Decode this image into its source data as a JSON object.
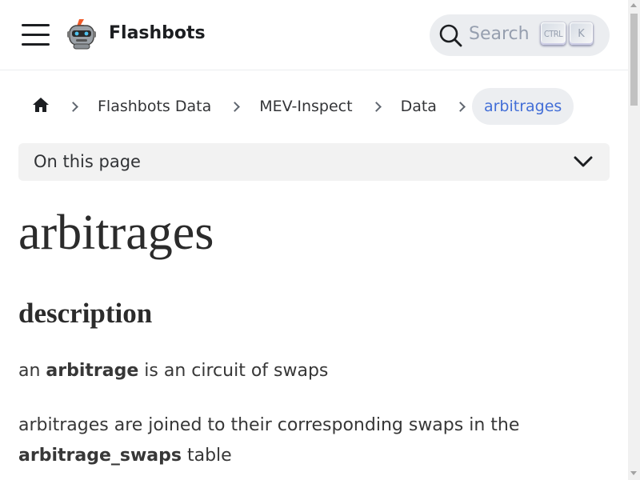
{
  "navbar": {
    "title": "Flashbots",
    "menu_icon": "hamburger-menu-icon",
    "logo_icon": "flashbots-robot-logo"
  },
  "search": {
    "placeholder": "Search",
    "shortcut_ctrl": "CTRL",
    "shortcut_key": "K",
    "icon": "search-icon"
  },
  "breadcrumbs": {
    "home_icon": "home-icon",
    "items": [
      {
        "label": "Flashbots Data"
      },
      {
        "label": "MEV-Inspect"
      },
      {
        "label": "Data"
      },
      {
        "label": "arbitrages"
      }
    ]
  },
  "toc": {
    "label": "On this page",
    "icon": "chevron-down-icon"
  },
  "content": {
    "title": "arbitrages",
    "section_heading": "description",
    "p1": {
      "pre": "an ",
      "strong": "arbitrage",
      "post": " is an circuit of swaps"
    },
    "p2": {
      "pre": "arbitrages are joined to their corresponding swaps in the ",
      "strong": "arbitrage_swaps",
      "post": " table"
    }
  },
  "colors": {
    "accent": "#2e5fd3",
    "search_bg": "#ebedf0",
    "toc_bg": "#f2f2f2"
  }
}
